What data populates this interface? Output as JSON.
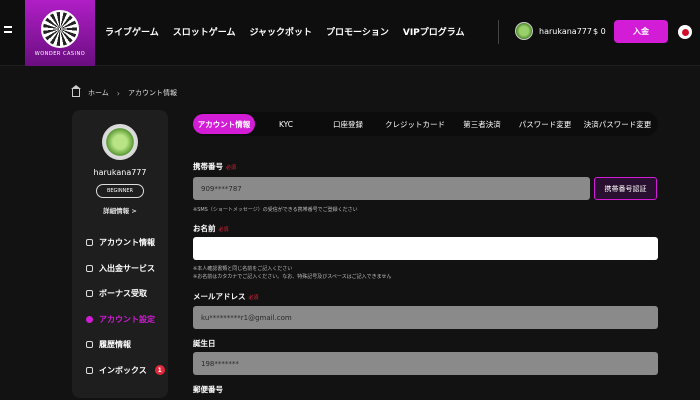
{
  "header": {
    "logo_text": "WONDER CASINO",
    "nav": [
      "ライブゲーム",
      "スロットゲーム",
      "ジャックポット",
      "プロモーション",
      "VIPプログラム"
    ],
    "username": "harukana777",
    "balance": "$ 0",
    "deposit_label": "入金"
  },
  "breadcrumb": {
    "home": "ホーム",
    "current": "アカウント情報"
  },
  "sidebar": {
    "username": "harukana777",
    "level": "BEGINNER",
    "details_link": "詳細情報 >",
    "menu": [
      {
        "label": "アカウント情報",
        "icon": "user-icon"
      },
      {
        "label": "入出金サービス",
        "icon": "wallet-icon"
      },
      {
        "label": "ボーナス受取",
        "icon": "gift-icon"
      },
      {
        "label": "アカウント設定",
        "icon": "settings-icon"
      },
      {
        "label": "履歴情報",
        "icon": "history-icon"
      },
      {
        "label": "インボックス",
        "icon": "mail-icon",
        "badge": "1"
      }
    ]
  },
  "tabs": [
    "アカウント情報",
    "KYC",
    "口座登録",
    "クレジットカード",
    "第三者決済",
    "パスワード変更",
    "決済パスワード変更"
  ],
  "form": {
    "required_label": "必須",
    "phone": {
      "label": "携帯番号",
      "value": "909****787",
      "button": "携帯番号認証",
      "note": "※SMS（ショートメッセージ）の受信ができる携帯番号でご登録ください"
    },
    "name": {
      "label": "お名前",
      "value": "",
      "note1": "※本人確認書類と同じ名前をご記入ください",
      "note2": "※お名前はカタカナでご記入ください。なお、特殊記号及びスペースはご記入できません"
    },
    "email": {
      "label": "メールアドレス",
      "value": "ku*********r1@gmail.com"
    },
    "birthday": {
      "label": "誕生日",
      "value": "198*******"
    },
    "postal": {
      "label": "郵便番号"
    }
  },
  "colors": {
    "accent": "#d21cd6",
    "background": "#121212",
    "panel": "#1e1e1e"
  }
}
